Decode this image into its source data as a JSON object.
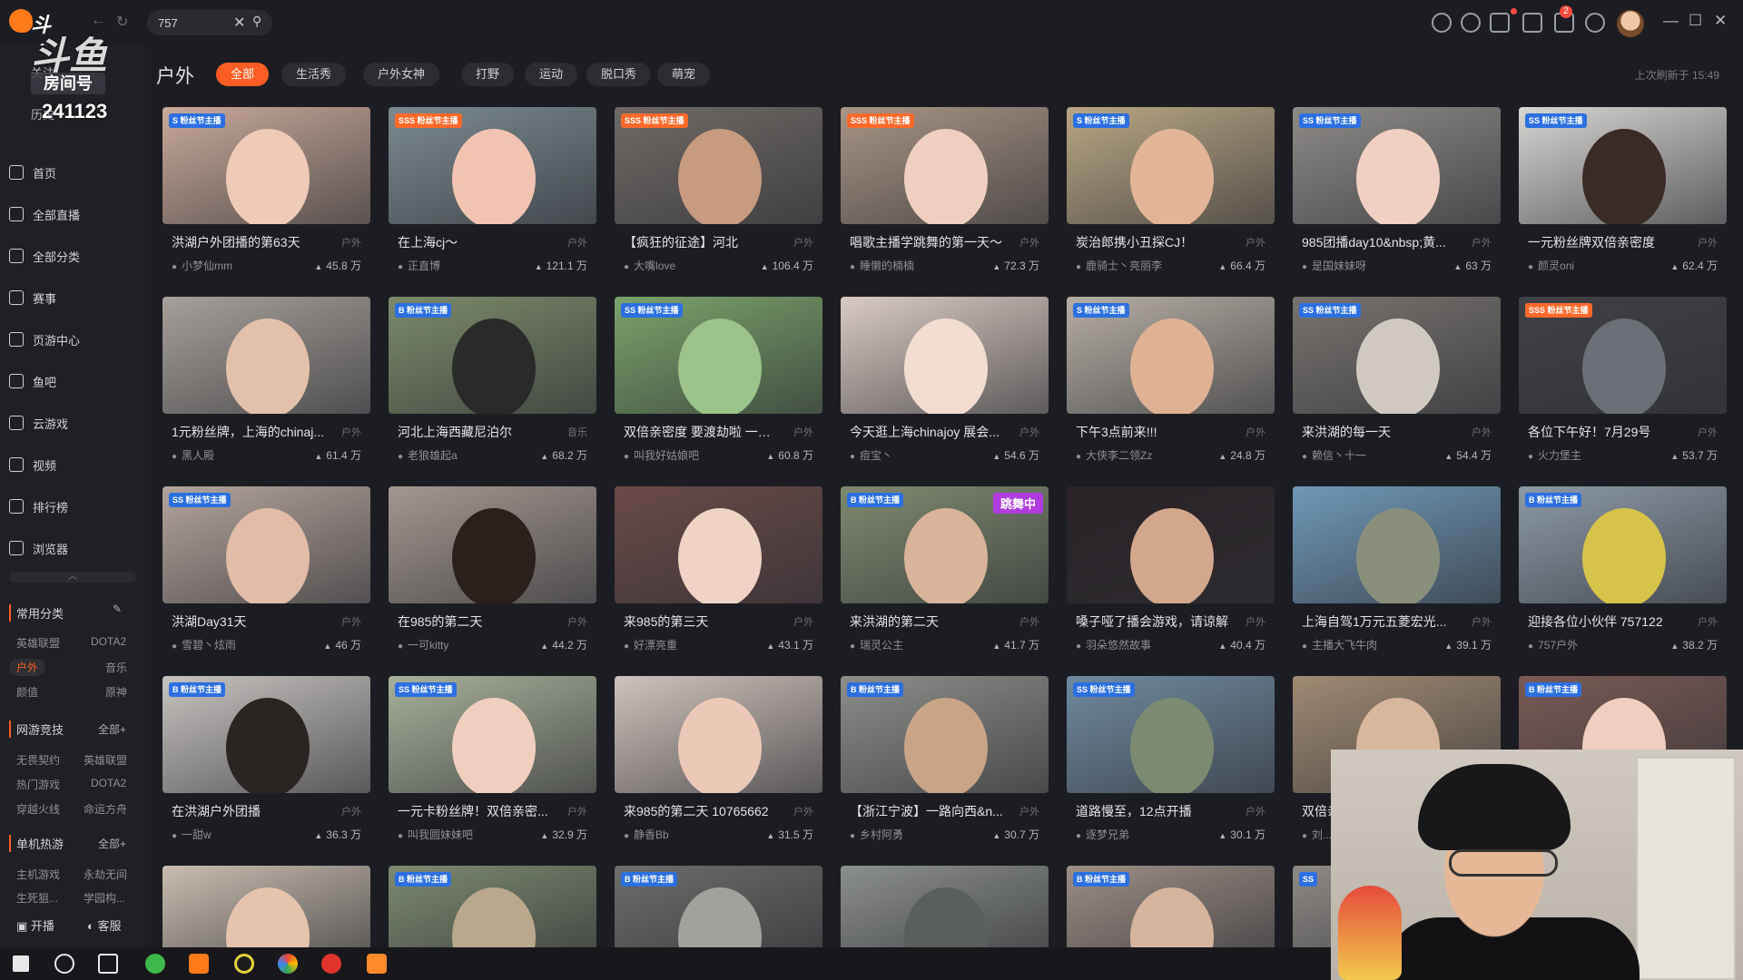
{
  "app": {
    "logo_text": "斗鱼"
  },
  "search": {
    "value": "757",
    "clear": "✕",
    "mag": "⚲"
  },
  "nav": {
    "back": "←",
    "refresh": "↻"
  },
  "toolbar": {
    "notify_count": "2"
  },
  "window": {
    "minimize": "—",
    "maximize": "☐",
    "close": "✕"
  },
  "overlay": {
    "big_text": "斗鱼",
    "label": "房间号",
    "room_number": "241123"
  },
  "sidebar": {
    "top_items": [
      {
        "label": "关注"
      },
      {
        "label": "历史"
      }
    ],
    "items": [
      {
        "label": "首页",
        "icon": "home-icon"
      },
      {
        "label": "全部直播",
        "icon": "live-icon"
      },
      {
        "label": "全部分类",
        "icon": "grid-icon"
      },
      {
        "label": "赛事",
        "icon": "trophy-icon"
      },
      {
        "label": "页游中心",
        "icon": "gamepad-icon"
      },
      {
        "label": "鱼吧",
        "icon": "fish-icon"
      },
      {
        "label": "云游戏",
        "icon": "cloud-game-icon"
      },
      {
        "label": "视频",
        "icon": "video-icon"
      },
      {
        "label": "排行榜",
        "icon": "rank-icon"
      },
      {
        "label": "浏览器",
        "icon": "browser-icon"
      }
    ],
    "common": {
      "title": "常用分类",
      "items": [
        "英雄联盟",
        "DOTA2",
        "户外",
        "音乐",
        "颜值",
        "原神"
      ]
    },
    "online": {
      "title": "网游竞技",
      "all": "全部+",
      "items": [
        "无畏契约",
        "英雄联盟",
        "热门游戏",
        "DOTA2",
        "穿越火线",
        "命运方舟"
      ]
    },
    "single": {
      "title": "单机热游",
      "all": "全部+",
      "items": [
        "主机游戏",
        "永劫无间",
        "生死狙...",
        "学园构..."
      ]
    },
    "bottom": {
      "broadcast": "开播",
      "service": "客服"
    }
  },
  "main": {
    "category_title": "户外",
    "tabs": [
      "全部",
      "生活秀",
      "户外女神",
      "打野",
      "运动",
      "脱口秀",
      "萌宠"
    ],
    "active_tab": 0,
    "refresh_time": "上次刷新于 15:49"
  },
  "cards": [
    {
      "title": "洪湖户外团播的第63天",
      "cat": "户外",
      "user": "小梦仙mm",
      "hot": "45.8 万",
      "badge": "S  粉丝节主播",
      "sss": false,
      "bg": "#c9a99a",
      "fc": "#efcab7"
    },
    {
      "title": "在上海cj～",
      "cat": "户外",
      "user": "正直博",
      "hot": "121.1 万",
      "badge": "SSS 粉丝节主播",
      "sss": true,
      "bg": "#7b8a8f",
      "fc": "#f1c3b0"
    },
    {
      "title": "【疯狂的征途】河北",
      "cat": "户外",
      "user": "大嘴love",
      "hot": "106.4 万",
      "badge": "SSS 粉丝节主播",
      "sss": true,
      "bg": "#6f6a66",
      "fc": "#c89a80"
    },
    {
      "title": "唱歌主播学跳舞的第一天～",
      "cat": "户外",
      "user": "睡懒的楠楠",
      "hot": "72.3 万",
      "badge": "SSS 粉丝节主播",
      "sss": true,
      "bg": "#a89585",
      "fc": "#f0cfc0"
    },
    {
      "title": "炭治郎携小丑探CJ！",
      "cat": "户外",
      "user": "鹿骑士丶亮丽李",
      "hot": "66.4 万",
      "badge": "S  粉丝节主播",
      "sss": false,
      "bg": "#b9a784",
      "fc": "#e3b496"
    },
    {
      "title": "985团播day10&nbsp;黄...",
      "cat": "户外",
      "user": "是国妹妹呀",
      "hot": "63 万",
      "badge": "SS 粉丝节主播",
      "sss": false,
      "bg": "#8e8b88",
      "fc": "#efd0c2"
    },
    {
      "title": "一元粉丝牌双倍亲密度",
      "cat": "户外",
      "user": "颜灵oni",
      "hot": "62.4 万",
      "badge": "SS 粉丝节主播",
      "sss": false,
      "bg": "#d8d6d3",
      "fc": "#3b2b26"
    },
    {
      "title": "1元粉丝牌，上海的chinaj...",
      "cat": "户外",
      "user": "黑人殿",
      "hot": "61.4 万",
      "badge": "",
      "sss": false,
      "bg": "#a6a09a",
      "fc": "#e3c0aa"
    },
    {
      "title": "河北上海西藏尼泊尔",
      "cat": "音乐",
      "user": "老狼雄起a",
      "hot": "68.2 万",
      "badge": "B  粉丝节主播",
      "sss": false,
      "bg": "#7c8a6a",
      "fc": "#2a2a2a"
    },
    {
      "title": "双倍亲密度 要渡劫啦 一起...",
      "cat": "户外",
      "user": "叫我好姑娘吧",
      "hot": "60.8 万",
      "badge": "SS 粉丝节主播",
      "sss": false,
      "bg": "#7aa36a",
      "fc": "#9cc48a"
    },
    {
      "title": "今天逛上海chinajoy 展会...",
      "cat": "户外",
      "user": "痘宝丶",
      "hot": "54.6 万",
      "badge": "",
      "sss": false,
      "bg": "#d9cbc3",
      "fc": "#f3dcd0"
    },
    {
      "title": "下午3点前来!!!",
      "cat": "户外",
      "user": "大侠李二领Zz",
      "hot": "24.8 万",
      "badge": "S  粉丝节主播",
      "sss": false,
      "bg": "#b5aea4",
      "fc": "#e0b192"
    },
    {
      "title": "来洪湖的每一天",
      "cat": "户外",
      "user": "赖信丶十一",
      "hot": "54.4 万",
      "badge": "SS 粉丝节主播",
      "sss": false,
      "bg": "#77736f",
      "fc": "#cfc9c2"
    },
    {
      "title": "各位下午好！7月29号",
      "cat": "户外",
      "user": "火力堡主",
      "hot": "53.7 万",
      "badge": "SSS 粉丝节主播",
      "sss": true,
      "bg": "#3f4147",
      "fc": "#6d6f76"
    },
    {
      "title": "洪湖Day31天",
      "cat": "户外",
      "user": "雪碧丶炫雨",
      "hot": "46 万",
      "badge": "SS 粉丝节主播",
      "sss": false,
      "bg": "#b3a49c",
      "fc": "#e2bca6"
    },
    {
      "title": "在985的第二天",
      "cat": "户外",
      "user": "一可kitty",
      "hot": "44.2 万",
      "badge": "",
      "sss": false,
      "bg": "#a39890",
      "fc": "#2b211c"
    },
    {
      "title": "来985的第三天",
      "cat": "户外",
      "user": "好漂亮重",
      "hot": "43.1 万",
      "badge": "",
      "sss": false,
      "bg": "#6a4a48",
      "fc": "#efd4c6"
    },
    {
      "title": "来洪湖的第二天",
      "cat": "户外",
      "user": "瑞灵公主",
      "hot": "41.7 万",
      "badge": "B  粉丝节主播",
      "sss": false,
      "bg": "#7e8a6f",
      "fc": "#d9b49a",
      "dance": "跳舞中"
    },
    {
      "title": "嗓子哑了播会游戏，请谅解",
      "cat": "户外",
      "user": "羽朵悠然故事",
      "hot": "40.4 万",
      "badge": "",
      "sss": false,
      "bg": "#2a2327",
      "fc": "#d3a78c"
    },
    {
      "title": "上海自驾1万元五菱宏光...",
      "cat": "户外",
      "user": "主播大飞牛肉",
      "hot": "39.1 万",
      "badge": "",
      "sss": false,
      "bg": "#6f98b7",
      "fc": "#8a8f7c"
    },
    {
      "title": "迎接各位小伙伴 757122",
      "cat": "户外",
      "user": "757户外",
      "hot": "38.2 万",
      "badge": "B  粉丝节主播",
      "sss": false,
      "bg": "#8c9aa6",
      "fc": "#d8c34a"
    },
    {
      "title": "在洪湖户外团播",
      "cat": "户外",
      "user": "一甜w",
      "hot": "36.3 万",
      "badge": "B  粉丝节主播",
      "sss": false,
      "bg": "#c7c3c0",
      "fc": "#2a2523"
    },
    {
      "title": "一元卡粉丝牌！双倍亲密...",
      "cat": "户外",
      "user": "叫我圆妹妹吧",
      "hot": "32.9 万",
      "badge": "SS 粉丝节主播",
      "sss": false,
      "bg": "#a8b09a",
      "fc": "#f1cfbf"
    },
    {
      "title": "来985的第二天 10765662",
      "cat": "户外",
      "user": "静香Bb",
      "hot": "31.5 万",
      "badge": "",
      "sss": false,
      "bg": "#cfc3bc",
      "fc": "#ecc8b6"
    },
    {
      "title": "【浙江宁波】一路向西&n...",
      "cat": "户外",
      "user": "乡村阿勇",
      "hot": "30.7 万",
      "badge": "B  粉丝节主播",
      "sss": false,
      "bg": "#8c8e8a",
      "fc": "#c9a487"
    },
    {
      "title": "道路慢至，12点开播",
      "cat": "户外",
      "user": "逐梦兄弟",
      "hot": "30.1 万",
      "badge": "SS 粉丝节主播",
      "sss": false,
      "bg": "#6f8aa0",
      "fc": "#7d8a72"
    },
    {
      "title": "双倍亲...",
      "cat": "户外",
      "user": "刘...",
      "hot": "",
      "badge": "",
      "sss": false,
      "bg": "#a08a72",
      "fc": "#d8b79c"
    },
    {
      "title": "",
      "cat": "户外",
      "user": "",
      "hot": "",
      "badge": "B  粉丝节主播",
      "sss": false,
      "bg": "#7a5a55",
      "fc": "#f0cfc0"
    },
    {
      "title": "",
      "cat": "",
      "user": "",
      "hot": "",
      "badge": "",
      "sss": false,
      "bg": "#c9bdb0",
      "fc": "#e5c3ad"
    },
    {
      "title": "",
      "cat": "",
      "user": "",
      "hot": "",
      "badge": "B  粉丝节主播",
      "sss": false,
      "bg": "#7d8a70",
      "fc": "#b9a88c"
    },
    {
      "title": "",
      "cat": "",
      "user": "",
      "hot": "",
      "badge": "B  粉丝节主播",
      "sss": false,
      "bg": "#6b6e6a",
      "fc": "#a0a39c"
    },
    {
      "title": "",
      "cat": "",
      "user": "",
      "hot": "",
      "badge": "",
      "sss": false,
      "bg": "#8b8f8c",
      "fc": "#5a5f5b"
    },
    {
      "title": "",
      "cat": "",
      "user": "",
      "hot": "",
      "badge": "B  粉丝节主播",
      "sss": false,
      "bg": "#9c8f86",
      "fc": "#d6b49e"
    },
    {
      "title": "",
      "cat": "",
      "user": "",
      "hot": "",
      "badge": "SS",
      "sss": false,
      "bg": "#8e8a86",
      "fc": "#b7a89a"
    }
  ]
}
